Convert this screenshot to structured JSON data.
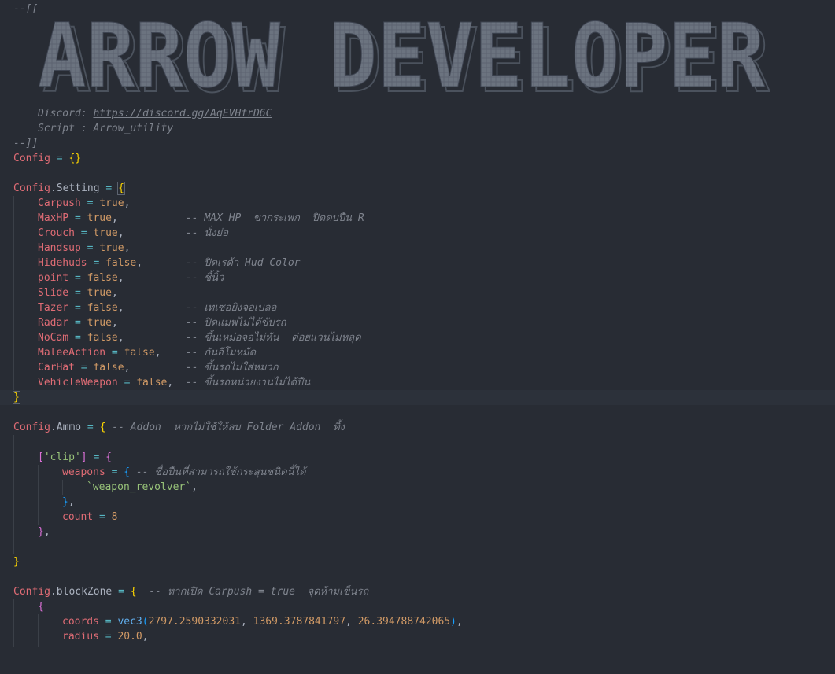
{
  "header": {
    "open": "--[[",
    "banner_text": "ARROW DEVELOPER",
    "discord_label": "Discord: ",
    "discord_url": "https://discord.gg/AqEVHfrD6C",
    "script_label": "Script : Arrow_utility",
    "close": "--]]"
  },
  "config_root": {
    "name": "Config",
    "op": " = ",
    "value": "{}"
  },
  "setting": {
    "object": "Config",
    "prop": ".Setting",
    "op": " = ",
    "open": "{",
    "close": "}",
    "items": [
      {
        "key": "Carpush",
        "value": "true",
        "pad": "",
        "comment": ""
      },
      {
        "key": "MaxHP",
        "value": "true",
        "pad": "           ",
        "comment": "-- MAX HP  ขากระเพก  ปิดดบปืน R"
      },
      {
        "key": "Crouch",
        "value": "true",
        "pad": "          ",
        "comment": "-- นั่งย่อ"
      },
      {
        "key": "Handsup",
        "value": "true",
        "pad": "",
        "comment": ""
      },
      {
        "key": "Hidehuds",
        "value": "false",
        "pad": "       ",
        "comment": "-- ปิดเรด้า Hud Color"
      },
      {
        "key": "point",
        "value": "false",
        "pad": "          ",
        "comment": "-- ชี้นิ้ว"
      },
      {
        "key": "Slide",
        "value": "true",
        "pad": "",
        "comment": ""
      },
      {
        "key": "Tazer",
        "value": "false",
        "pad": "          ",
        "comment": "-- เทเซอยิงจอเบลอ"
      },
      {
        "key": "Radar",
        "value": "true",
        "pad": "           ",
        "comment": "-- ปิดแมพไม่ได้ขับรถ"
      },
      {
        "key": "NoCam",
        "value": "false",
        "pad": "          ",
        "comment": "-- ขึ้นเหม่อจอไม่หัน  ต่อยแว่นไม่หลุด"
      },
      {
        "key": "MaleeAction",
        "value": "false",
        "pad": "    ",
        "comment": "-- กันอีโมหมัด"
      },
      {
        "key": "CarHat",
        "value": "false",
        "pad": "         ",
        "comment": "-- ขึ้นรถไม่ใส่หมวก"
      },
      {
        "key": "VehicleWeapon",
        "value": "false",
        "pad": "  ",
        "comment": "-- ขึ้นรถหน่วยงานไม่ได้ปืน"
      }
    ]
  },
  "ammo": {
    "object": "Config",
    "prop": ".Ammo",
    "op": " = ",
    "open": "{",
    "comment": " -- Addon  หากไม่ใช้ให้ลบ Folder Addon  ทิ้ง",
    "clip_open_a": "[",
    "clip_key": "'clip'",
    "clip_open_b": "]",
    "clip_eq": " = ",
    "clip_brace": "{",
    "weapons_key": "weapons",
    "weapons_eq": " = ",
    "weapons_open": "{",
    "weapons_comment": " -- ชื่อปืนที่สามารถใช้กระสุนชนิดนี้ได้",
    "weapon_value": "`weapon_revolver`",
    "weapon_comma": ",",
    "weapons_close": "}",
    "weapons_close_comma": ",",
    "count_key": "count",
    "count_eq": " = ",
    "count_value": "8",
    "clip_close": "}",
    "clip_close_comma": ",",
    "close": "}"
  },
  "blockzone": {
    "object": "Config",
    "prop": ".blockZone",
    "op": " = ",
    "open": "{",
    "comment": "  -- หากเปิด Carpush = true  จุดห้ามเข็นรถ",
    "item_open": "{",
    "coords_key": "coords",
    "coords_eq": " = ",
    "coords_fn": "vec3",
    "coords_paren_open": "(",
    "coords_x": "2797.2590332031",
    "coords_y": "1369.3787841797",
    "coords_z": "26.394788742065",
    "coords_sep": ", ",
    "coords_paren_close": ")",
    "coords_comma": ",",
    "radius_key": "radius",
    "radius_eq": " = ",
    "radius_value": "20.0",
    "radius_comma": ","
  },
  "colors": {
    "background": "#282c34",
    "comment": "#7f848e",
    "variable": "#e06c75",
    "operator": "#56b6c2",
    "boolean": "#d19a66",
    "string": "#98c379",
    "function": "#61afef",
    "bracket_level1": "#ffd700",
    "bracket_level2": "#da70d6",
    "bracket_level3": "#179fff"
  }
}
